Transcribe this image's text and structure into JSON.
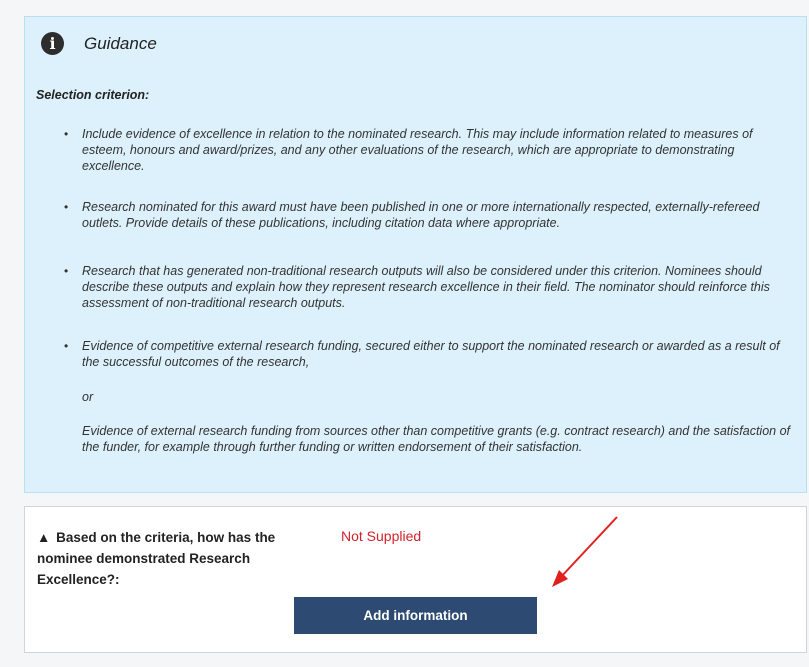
{
  "guidance": {
    "title": "Guidance",
    "icon": "info-icon",
    "criterion_label": "Selection criterion:",
    "items": [
      "Include evidence of excellence in relation to the nominated research. This may include information related to measures of esteem, honours and award/prizes, and any other evaluations of the research, which are appropriate to demonstrating excellence.",
      "Research nominated for this award must have been published in one or more internationally respected, externally-refereed outlets. Provide details of these publications, including citation data where appropriate.",
      "Research that has generated non-traditional research outputs will also be considered under this criterion. Nominees should describe these outputs and explain how they represent research excellence in their field. The nominator should reinforce this assessment of non-traditional research outputs.",
      "Evidence of competitive external research funding, secured either to support the nominated research or awarded as a result of the successful outcomes of the research,"
    ],
    "or_text": "or",
    "extra_text": "Evidence of external research funding from sources other than competitive grants (e.g. contract research) and the satisfaction of the funder, for example through further funding or written endorsement of their satisfaction."
  },
  "answer": {
    "question": "Based on the criteria, how has the nominee demonstrated Research Excellence?:",
    "status": "Not Supplied",
    "button_label": "Add information",
    "warning_icon": "warning-triangle-icon"
  },
  "colors": {
    "guidance_bg": "#dcf1fb",
    "status_red": "#d2232a",
    "button_bg": "#2d4a72",
    "arrow": "#e02020"
  }
}
